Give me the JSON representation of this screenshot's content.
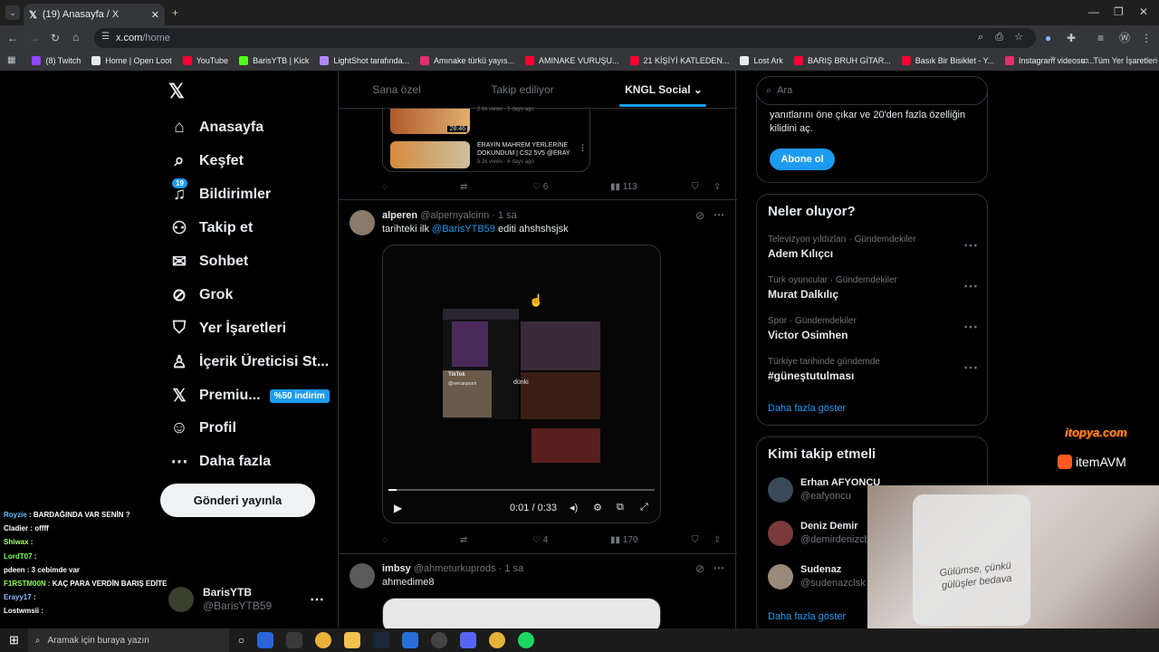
{
  "browser": {
    "tab_title": "(19) Anasayfa / X",
    "url_domain": "x.com",
    "url_path": "/home",
    "bookmarks": [
      {
        "label": "(8) Twitch",
        "color": "#9146ff"
      },
      {
        "label": "Home | Open Loot",
        "color": "#e8eaed"
      },
      {
        "label": "YouTube",
        "color": "#ff0033"
      },
      {
        "label": "BarisYTB | Kick",
        "color": "#53fc18"
      },
      {
        "label": "LightShot tarafında...",
        "color": "#b388ff"
      },
      {
        "label": "Amınake türkü yayıs...",
        "color": "#e1306c"
      },
      {
        "label": "AMINAKE VURUŞU...",
        "color": "#ff0033"
      },
      {
        "label": "21 KİŞİYİ KATLEDEN...",
        "color": "#ff0033"
      },
      {
        "label": "Lost Ark",
        "color": "#e8eaed"
      },
      {
        "label": "BARIŞ BRUH GİTAR...",
        "color": "#ff0033"
      },
      {
        "label": "Basık Bir Bisiklet - Y...",
        "color": "#ff0033"
      },
      {
        "label": "Instagram videosu:...",
        "color": "#e1306c"
      }
    ],
    "all_bookmarks": "Tüm Yer İşaretleri"
  },
  "sidebar": {
    "items": [
      {
        "label": "Anasayfa",
        "icon": "home-icon",
        "glyph": "⌂"
      },
      {
        "label": "Keşfet",
        "icon": "search-icon",
        "glyph": "⌕"
      },
      {
        "label": "Bildirimler",
        "icon": "bell-icon",
        "glyph": "♫",
        "badge": "19"
      },
      {
        "label": "Takip et",
        "icon": "add-person-icon",
        "glyph": "⚇"
      },
      {
        "label": "Sohbet",
        "icon": "mail-icon",
        "glyph": "✉"
      },
      {
        "label": "Grok",
        "icon": "grok-icon",
        "glyph": "⊘"
      },
      {
        "label": "Yer İşaretleri",
        "icon": "bookmark-icon",
        "glyph": "⛉"
      },
      {
        "label": "İçerik Üreticisi St...",
        "icon": "creator-icon",
        "glyph": "♙"
      },
      {
        "label": "Premiu...",
        "icon": "x-premium-icon",
        "glyph": "𝕏",
        "badge": "%50 indirim"
      },
      {
        "label": "Profil",
        "icon": "person-icon",
        "glyph": "☺"
      },
      {
        "label": "Daha fazla",
        "icon": "more-circle-icon",
        "glyph": "⋯"
      }
    ],
    "post_button": "Gönderi yayınla",
    "account": {
      "name": "BarisYTB",
      "handle": "@BarisYTB59"
    }
  },
  "feed": {
    "tabs": [
      "Sana özel",
      "Takip ediliyor",
      "KNGL Social"
    ],
    "quoted_videos": [
      {
        "duration": "28:46",
        "title": "",
        "meta": "2.6k views · 5 days ago"
      },
      {
        "duration": "",
        "title": "ERAYIN MAHREM YERLERİNE DOKUNDUM | CS2 5V5 @ERAY",
        "meta": "5.3k views · 6 days ago"
      }
    ],
    "post0_actions": {
      "likes": "6",
      "views": "113"
    },
    "post1": {
      "name": "alperen",
      "handle": "@alpernyalcinn",
      "time": "1 sa",
      "text_prefix": "tarihteki ilk ",
      "mention": "@BarisYTB59",
      "text_suffix": " editi ahshshsjsk",
      "video": {
        "time": "0:01 / 0:33",
        "progress": 0.03,
        "center_label": "dünki",
        "tiktok": "TikTok",
        "tiktok_user": "@sercanpurni"
      },
      "likes": "4",
      "views": "170"
    },
    "post2": {
      "name": "imbsy",
      "handle": "@ahmeturkuprods",
      "time": "1 sa",
      "text": "ahmedime8"
    }
  },
  "right": {
    "search_placeholder": "Ara",
    "premium": {
      "text": "yanıtlarını öne çıkar ve 20'den fazla özelliğin kilidini aç.",
      "button": "Abone ol"
    },
    "trends_title": "Neler oluyor?",
    "trends": [
      {
        "cat": "Televizyon yıldızları · Gündemdekiler",
        "name": "Adem Kılıçcı"
      },
      {
        "cat": "Türk oyuncular · Gündemdekiler",
        "name": "Murat Dalkılıç"
      },
      {
        "cat": "Spor · Gündemdekiler",
        "name": "Victor Osimhen"
      },
      {
        "cat": "Türkiye tarihinde gündemde",
        "name": "#güneştutulması"
      }
    ],
    "show_more": "Daha fazla göster",
    "wtf_title": "Kimi takip etmeli",
    "wtf": [
      {
        "name": "Erhan AFYONCU",
        "handle": "@eafyoncu"
      },
      {
        "name": "Deniz Demir",
        "handle": "@demirdenizcb"
      },
      {
        "name": "Sudenaz",
        "handle": "@sudenazclsk"
      }
    ],
    "show_more2": "Daha fazla göster"
  },
  "overlay": {
    "sponsor1": "itopya.com",
    "sponsor2": "itemAVM",
    "cam_text": "Gülümse, çünkü gülüşler bedava",
    "chat": [
      {
        "user": "Royzie",
        "msg": "BARDAĞINDA  VAR SENİN ?",
        "color": "#5bc0ff"
      },
      {
        "user": "Cladier",
        "msg": "offff",
        "color": "#ffffff"
      },
      {
        "user": "Shiwax",
        "msg": "",
        "color": "#b0ff6b"
      },
      {
        "user": "LordT07",
        "msg": "",
        "color": "#7cff5a"
      },
      {
        "user": "pdeen",
        "msg": "3 cebimde var",
        "color": "#ffffff"
      },
      {
        "user": "F1RSTM00N",
        "msg": "KAÇ PARA VERDİN BARIŞ EDİTE",
        "color": "#8cff4f"
      },
      {
        "user": "Erayy17",
        "msg": "",
        "color": "#8fb8ff"
      },
      {
        "user": "Lostwmsii",
        "msg": "",
        "color": "#ffffff"
      }
    ]
  },
  "taskbar": {
    "search_placeholder": "Aramak için buraya yazın"
  }
}
